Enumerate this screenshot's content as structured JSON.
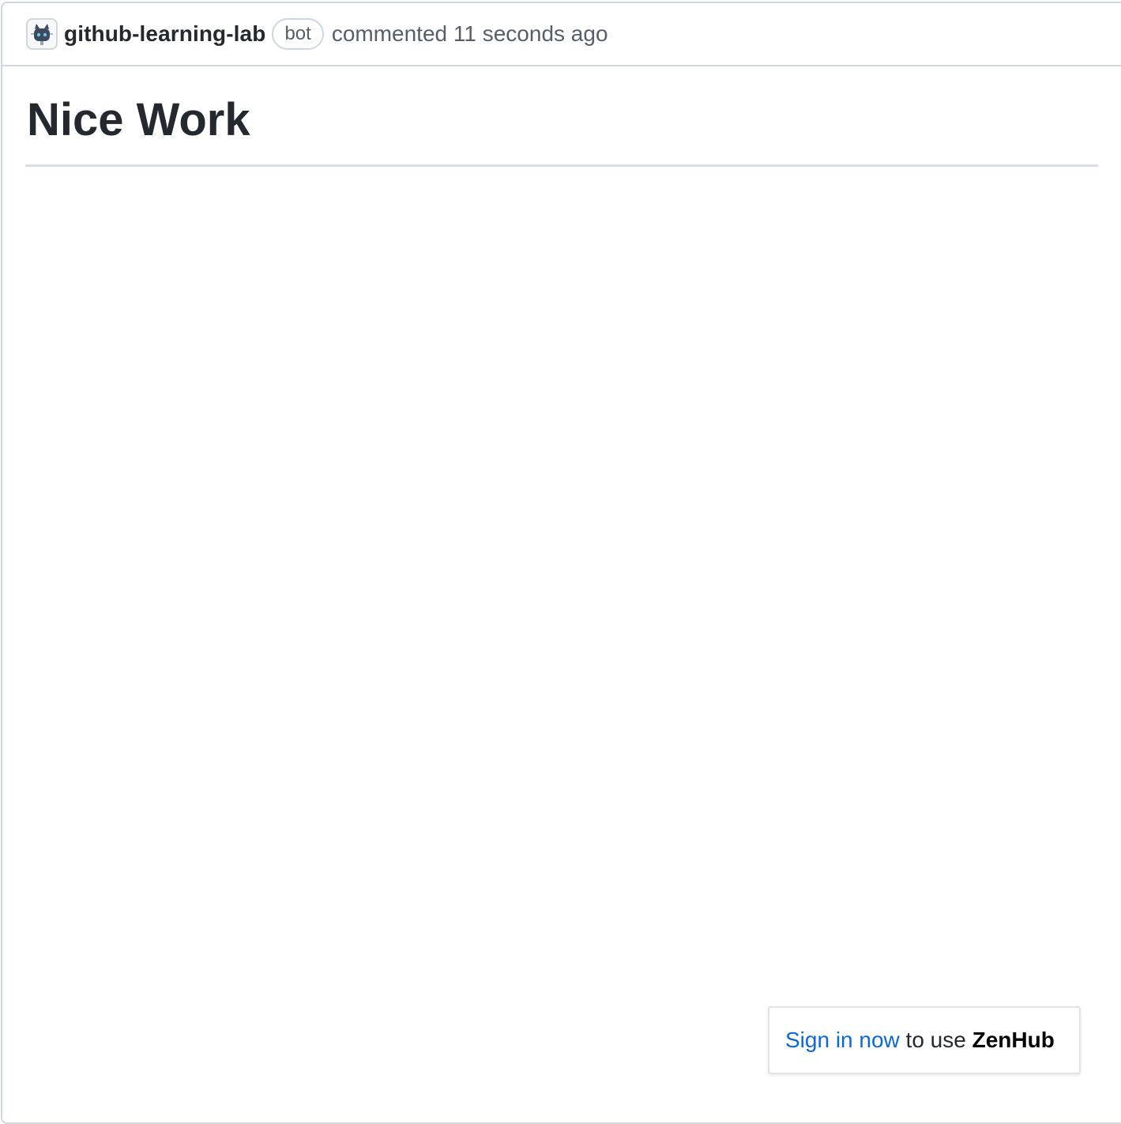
{
  "comment": {
    "author": "github-learning-lab",
    "badge": "bot",
    "action": "commented",
    "timestamp": "11 seconds ago",
    "avatar_icon": "octocat-robot-icon"
  },
  "body": {
    "heading": "Nice Work"
  },
  "zenhub": {
    "link_label": "Sign in now",
    "middle_text": "to use",
    "brand": "ZenHub"
  },
  "colors": {
    "border": "#d0d7de",
    "muted_text": "#57606a",
    "link": "#0969da",
    "text": "#24292f"
  }
}
